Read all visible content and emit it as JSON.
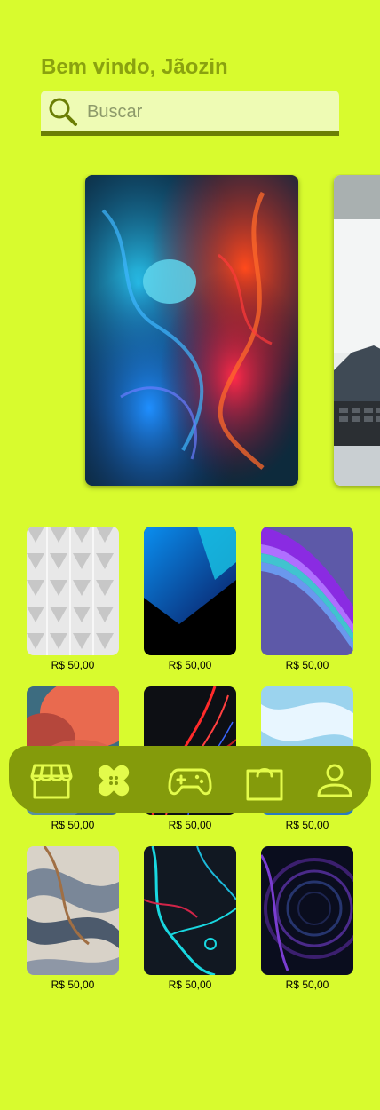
{
  "header": {
    "greeting": "Bem vindo, Jãozin"
  },
  "search": {
    "placeholder": "Buscar",
    "value": ""
  },
  "featured": [
    {
      "image": "abstract-colored-smoke"
    },
    {
      "image": "laptop-on-desk"
    }
  ],
  "products": [
    {
      "image": "white-3d-geometric-wall",
      "price": "R$ 50,00"
    },
    {
      "image": "blue-black-gradient",
      "price": "R$ 50,00"
    },
    {
      "image": "purple-wave-abstract",
      "price": "R$ 50,00"
    },
    {
      "image": "red-blue-clouds",
      "price": "R$ 50,00"
    },
    {
      "image": "red-light-trails",
      "price": "R$ 50,00"
    },
    {
      "image": "blue-marble-fluid",
      "price": "R$ 50,00"
    },
    {
      "image": "swirled-grey-fluid",
      "price": "R$ 50,00"
    },
    {
      "image": "cyan-neon-veins",
      "price": "R$ 50,00"
    },
    {
      "image": "dark-purple-spiral",
      "price": "R$ 50,00"
    }
  ],
  "nav": [
    {
      "icon": "store-icon"
    },
    {
      "icon": "bandage-icon"
    },
    {
      "icon": "gamepad-icon"
    },
    {
      "icon": "shopping-bag-icon"
    },
    {
      "icon": "user-icon"
    }
  ],
  "colors": {
    "background": "#d8fb2e",
    "greeting_text": "#8aa20f",
    "search_bg": "#eefbb4",
    "search_underline": "#6b7e05",
    "navbar_bg": "#849b0b",
    "navbar_icon": "#e3fb4b"
  }
}
